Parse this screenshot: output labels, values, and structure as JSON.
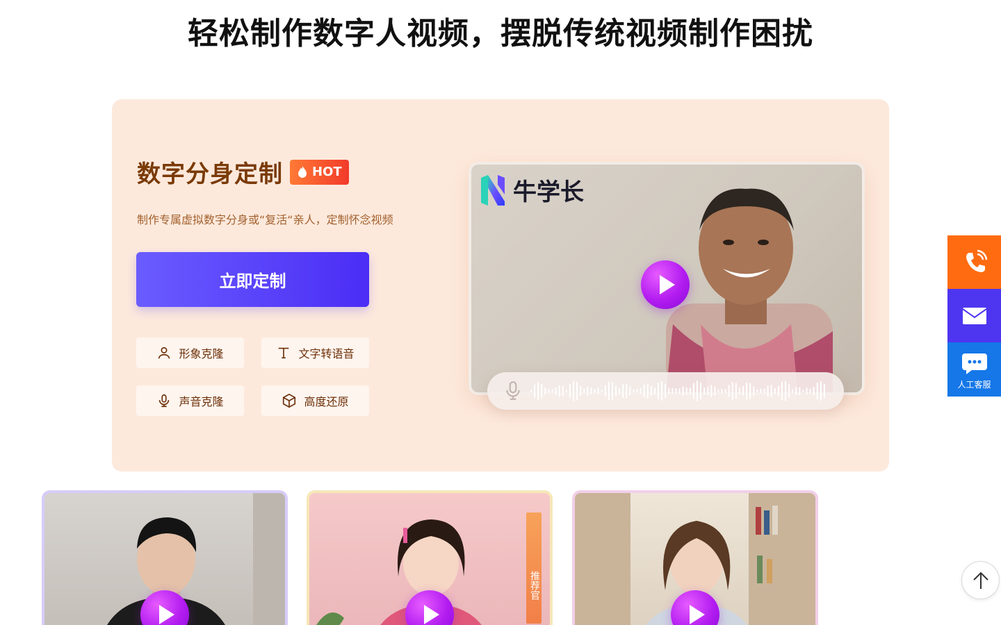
{
  "headline": "轻松制作数字人视频，摆脱传统视频制作困扰",
  "hero": {
    "title": "数字分身定制",
    "badge": "HOT",
    "subtitle": "制作专属虚拟数字分身或“复活“亲人，定制怀念视频",
    "cta_label": "立即定制",
    "features": [
      {
        "label": "形象克隆",
        "icon": "person-icon"
      },
      {
        "label": "文字转语音",
        "icon": "text-icon"
      },
      {
        "label": "声音克隆",
        "icon": "mic-icon"
      },
      {
        "label": "高度还原",
        "icon": "cube-icon"
      }
    ],
    "video": {
      "brand_name": "牛学长"
    }
  },
  "side_rail": {
    "chat_label": "人工客服"
  },
  "cards": [
    {
      "name": "male-avatar"
    },
    {
      "name": "girl-avatar",
      "tag": "推荐官"
    },
    {
      "name": "woman-avatar"
    }
  ],
  "colors": {
    "hero_bg": "#fde9dc",
    "title_brown": "#7a3a06",
    "cta_purple": "#5b40f6",
    "hot_red": "#f23a2a",
    "side_orange": "#ff6b10",
    "side_purple": "#4e36f0",
    "side_blue": "#1577e8"
  }
}
